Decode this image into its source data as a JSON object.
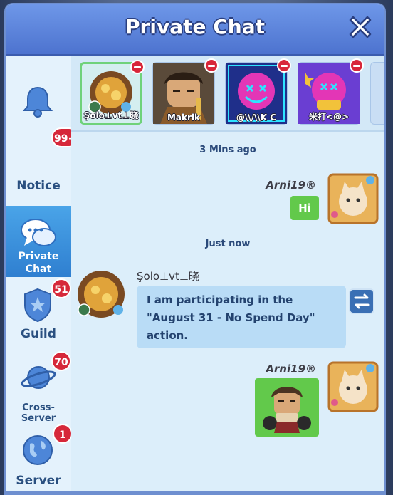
{
  "window": {
    "title": "Private Chat"
  },
  "sidebar": {
    "items": [
      {
        "label": "Notice",
        "badge": "99+"
      },
      {
        "label_line1": "Private",
        "label_line2": "Chat",
        "badge": ""
      },
      {
        "label": "Guild",
        "badge": "51"
      },
      {
        "label": "Cross-Server",
        "badge": "70"
      },
      {
        "label": "Server",
        "badge": "1"
      }
    ]
  },
  "contacts": [
    {
      "name": "Şolo⊥vt⊥晓"
    },
    {
      "name": "Makrik"
    },
    {
      "name": "@\\\\/\\\\K C"
    },
    {
      "name": "米打<@>"
    }
  ],
  "conversation": {
    "time_1": "3 Mins ago",
    "time_2": "Just now",
    "messages": [
      {
        "sender": "Arni19®",
        "text": "Hi"
      },
      {
        "sender": "Şolo⊥vt⊥晓",
        "text_line1": "I am participating in the",
        "text_line2": "\"August 31 - No Spend Day\"",
        "text_line3": "action."
      },
      {
        "sender": "Arni19®",
        "text": ""
      }
    ]
  },
  "colors": {
    "header": "#5a82db",
    "accent_green": "#62c94b",
    "badge_red": "#d6283a",
    "bubble_blue": "#b9dcf6"
  }
}
